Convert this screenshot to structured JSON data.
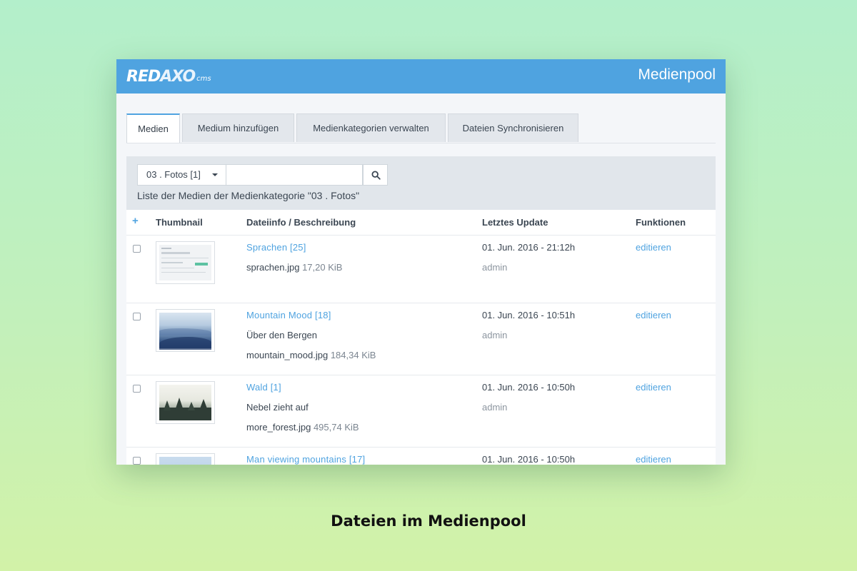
{
  "header": {
    "logo_main": "RED",
    "logo_accent": "AXO",
    "logo_suffix": "cms",
    "title": "Medienpool",
    "color": "#4fa3e0"
  },
  "tabs": [
    {
      "label": "Medien",
      "active": true
    },
    {
      "label": "Medium hinzufügen",
      "active": false
    },
    {
      "label": "Medienkategorien verwalten",
      "active": false
    },
    {
      "label": "Dateien Synchronisieren",
      "active": false
    }
  ],
  "filter": {
    "category_select": "03 . Fotos [1]",
    "search_value": "",
    "search_icon": "search-icon"
  },
  "list_caption": "Liste der Medien der Medienkategorie \"03 . Fotos\"",
  "columns": {
    "add": "+",
    "thumbnail": "Thumbnail",
    "info": "Dateiinfo / Beschreibung",
    "updated": "Letztes Update",
    "functions": "Funktionen"
  },
  "rows": [
    {
      "title": "Sprachen [25]",
      "description": "",
      "filename": "sprachen.jpg",
      "size": "17,20 KiB",
      "date": "01. Jun. 2016 - 21:12h",
      "user": "admin",
      "action": "editieren",
      "thumb": "screenshot"
    },
    {
      "title": "Mountain Mood [18]",
      "description": "Über den Bergen",
      "filename": "mountain_mood.jpg",
      "size": "184,34 KiB",
      "date": "01. Jun. 2016 - 10:51h",
      "user": "admin",
      "action": "editieren",
      "thumb": "mountains"
    },
    {
      "title": "Wald [1]",
      "description": "Nebel zieht auf",
      "filename": "more_forest.jpg",
      "size": "495,74 KiB",
      "date": "01. Jun. 2016 - 10:50h",
      "user": "admin",
      "action": "editieren",
      "thumb": "forest"
    },
    {
      "title": "Man viewing mountains [17]",
      "description": "",
      "filename": "",
      "size": "",
      "date": "01. Jun. 2016 - 10:50h",
      "user": "",
      "action": "editieren",
      "thumb": "sky"
    }
  ],
  "caption": "Dateien im Medienpool"
}
